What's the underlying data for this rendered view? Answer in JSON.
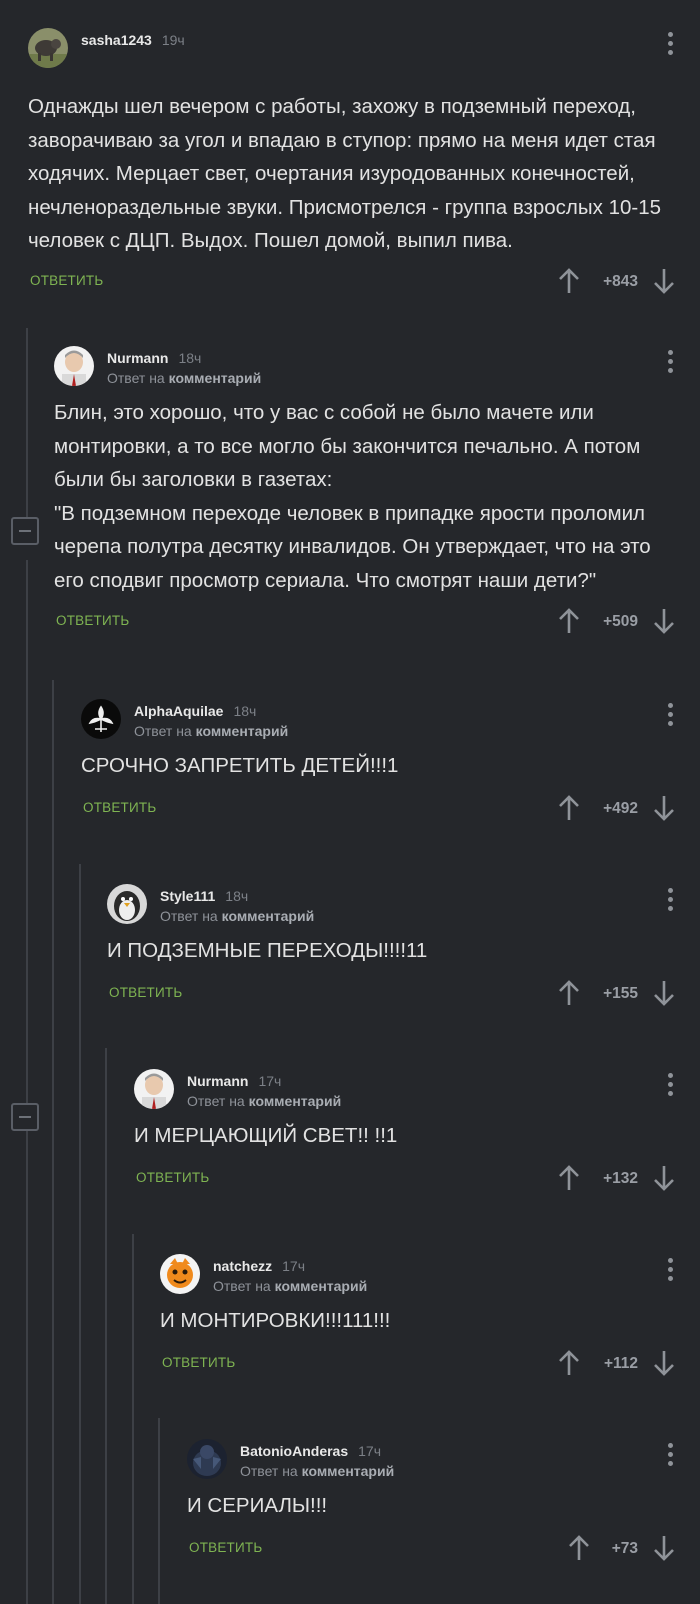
{
  "reply_label": "ОТВЕТИТЬ",
  "reply_prefix": "Ответ на",
  "reply_target": "комментарий",
  "comments": [
    {
      "user": "sasha1243",
      "time": "19ч",
      "text": "Однажды шел вечером с работы, захожу в подземный переход, заворачиваю за угол и впадаю в ступор: прямо на меня идет стая ходячих. Мерцает свет, очертания изуродованных конечностей, нечленораздельные звуки. Присмотрелся - группа взрослых 10-15 человек с ДЦП. Выдох. Пошел домой, выпил пива.",
      "rating": "+843"
    },
    {
      "user": "Nurmann",
      "time": "18ч",
      "text": "Блин, это хорошо, что у вас с собой не было мачете или монтировки, а то все могло бы закончится печально. А потом были бы заголовки в газетах:\n\"В подземном переходе человек в припадке ярости проломил черепа полутра десятку инвалидов. Он утверждает, что на это его сподвиг просмотр сериала. Что смотрят наши дети?\"",
      "rating": "+509"
    },
    {
      "user": "AlphaAquilae",
      "time": "18ч",
      "text": "СРОЧНО ЗАПРЕТИТЬ ДЕТЕЙ!!!1",
      "rating": "+492"
    },
    {
      "user": "Style111",
      "time": "18ч",
      "text": "И ПОДЗЕМНЫЕ ПЕРЕХОДЫ!!!!11",
      "rating": "+155"
    },
    {
      "user": "Nurmann",
      "time": "17ч",
      "text": "И МЕРЦАЮЩИЙ СВЕТ!! !!1",
      "rating": "+132"
    },
    {
      "user": "natchezz",
      "time": "17ч",
      "text": "И МОНТИРОВКИ!!!111!!!",
      "rating": "+112"
    },
    {
      "user": "BatonioAnderas",
      "time": "17ч",
      "text": "И СЕРИАЛЫ!!!",
      "rating": "+73"
    }
  ],
  "colors": {
    "background": "#25272b",
    "accent": "#7fb452",
    "muted": "#8f9399"
  }
}
